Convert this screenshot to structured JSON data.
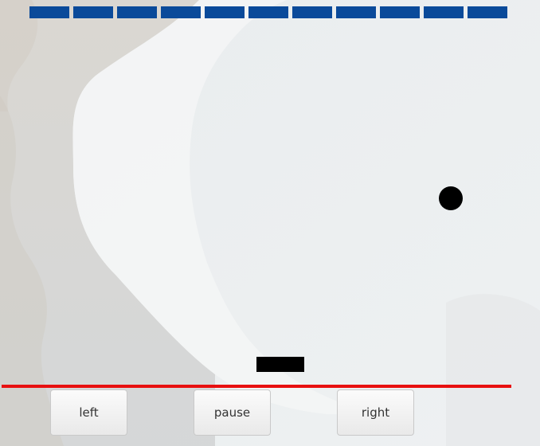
{
  "game": {
    "bricks_count": 11,
    "brick_color": "#0a4a9a",
    "ball_color": "#000000",
    "paddle_color": "#000000",
    "floor_line_color": "#e81010"
  },
  "controls": {
    "left_label": "left",
    "pause_label": "pause",
    "right_label": "right"
  }
}
